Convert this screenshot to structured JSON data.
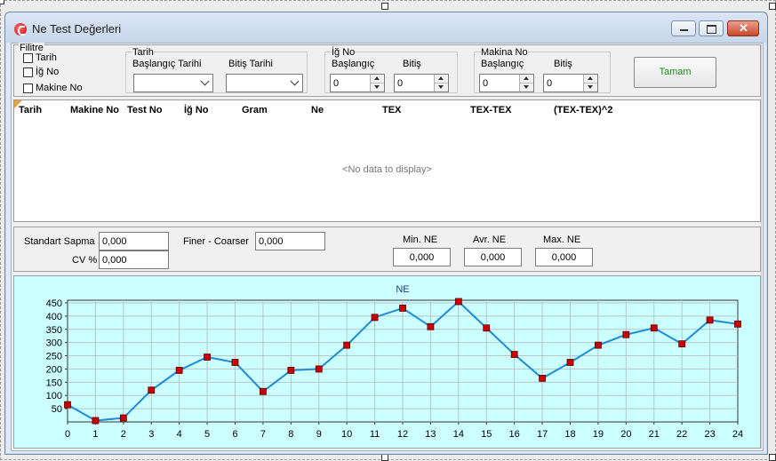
{
  "window": {
    "title": "Ne Test Değerleri"
  },
  "filter": {
    "title": "Filitre",
    "checks": [
      {
        "label": "Tarih",
        "checked": false
      },
      {
        "label": "İğ No",
        "checked": false
      },
      {
        "label": "Makine No",
        "checked": false
      }
    ],
    "date_group": {
      "title": "Tarih",
      "start_label": "Başlangıç Tarihi",
      "end_label": "Bitiş Tarihi",
      "start_value": "",
      "end_value": ""
    },
    "spindle_group": {
      "title": "İğ No",
      "start_label": "Başlangıç",
      "end_label": "Bitiş",
      "start_value": "0",
      "end_value": "0"
    },
    "machine_group": {
      "title": "Makina No",
      "start_label": "Başlangıç",
      "end_label": "Bitiş",
      "start_value": "0",
      "end_value": "0"
    },
    "ok_label": "Tamam"
  },
  "grid": {
    "columns": [
      "Tarih",
      "Makine No",
      "Test No",
      "İğ No",
      "Gram",
      "Ne",
      "TEX",
      "TEX-TEX",
      "(TEX-TEX)^2"
    ],
    "empty_text": "<No data to display>"
  },
  "stats": {
    "std_label": "Standart Sapma",
    "std_value": "0,000",
    "cv_label": "CV %",
    "cv_value": "0,000",
    "fc_label": "Finer - Coarser",
    "fc_value": "0,000",
    "min_label": "Min. NE",
    "min_value": "0,000",
    "avg_label": "Avr. NE",
    "avg_value": "0,000",
    "max_label": "Max. NE",
    "max_value": "0,000"
  },
  "colors": {
    "chart_bg": "#ccffff",
    "line": "#1f8ad6",
    "marker": "#cc0000",
    "ok_text": "#1b8a1b",
    "title_text": "#1f3a8a"
  },
  "chart_data": {
    "type": "line",
    "title": "NE",
    "xlabel": "",
    "ylabel": "",
    "x": [
      0,
      1,
      2,
      3,
      4,
      5,
      6,
      7,
      8,
      9,
      10,
      11,
      12,
      13,
      14,
      15,
      16,
      17,
      18,
      19,
      20,
      21,
      22,
      23,
      24
    ],
    "series": [
      {
        "values": [
          65,
          5,
          15,
          120,
          195,
          245,
          225,
          115,
          195,
          200,
          290,
          395,
          430,
          360,
          455,
          355,
          255,
          165,
          225,
          290,
          330,
          355,
          295,
          385,
          370
        ]
      }
    ],
    "xlim": [
      0,
      24
    ],
    "ylim": [
      0,
      460
    ],
    "yticks": [
      50,
      100,
      150,
      200,
      250,
      300,
      350,
      400,
      450
    ],
    "xticks": [
      0,
      1,
      2,
      3,
      4,
      5,
      6,
      7,
      8,
      9,
      10,
      11,
      12,
      13,
      14,
      15,
      16,
      17,
      18,
      19,
      20,
      21,
      22,
      23,
      24
    ],
    "grid": true,
    "legend": "none"
  }
}
